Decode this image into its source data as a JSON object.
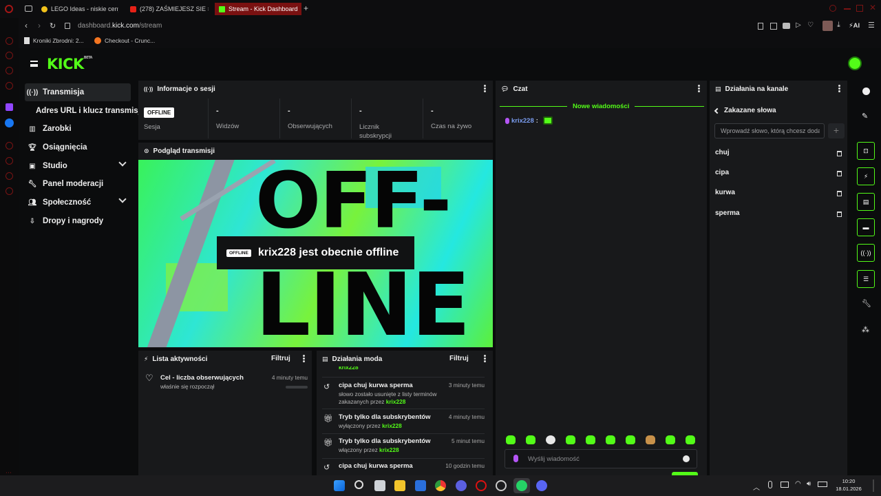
{
  "browser": {
    "tabs": [
      {
        "label": "LEGO Ideas - niskie ceny i..."
      },
      {
        "label": "(278) ZAŚMIEJESZ SIE = ..."
      },
      {
        "label": "Stream - Kick Dashboard"
      }
    ],
    "url_prefix": "dashboard.",
    "url_domain": "kick.com",
    "url_path": "/stream",
    "ai_label": "AI",
    "bookmarks": [
      {
        "label": "Kroniki Zbrodni: 2..."
      },
      {
        "label": "Checkout - Crunc..."
      }
    ]
  },
  "kick": {
    "logo": "KICK",
    "logo_badge": "BETA",
    "nav": [
      {
        "label": "Transmisja",
        "icon": "broadcast-icon"
      },
      {
        "label": "Adres URL i klucz transmisji",
        "icon": ""
      },
      {
        "label": "Zarobki",
        "icon": "chart-icon"
      },
      {
        "label": "Osiągnięcia",
        "icon": "trophy-icon"
      },
      {
        "label": "Studio",
        "icon": "studio-icon"
      },
      {
        "label": "Panel moderacji",
        "icon": "wrench-icon"
      },
      {
        "label": "Społeczność",
        "icon": "people-icon"
      },
      {
        "label": "Dropy i nagrody",
        "icon": "drops-icon"
      }
    ],
    "session": {
      "title": "Informacje o sesji",
      "status_badge": "OFFLINE",
      "status_label": "Sesja",
      "stats": [
        {
          "value": "-",
          "label": "Widzów"
        },
        {
          "value": "-",
          "label": "Obserwujących"
        },
        {
          "value": "-",
          "label": "Licznik subskrypcji"
        },
        {
          "value": "-",
          "label": "Czas na żywo"
        }
      ]
    },
    "preview": {
      "title": "Podgląd transmisji",
      "badge": "OFFLINE",
      "message": "krix228 jest obecnie offline",
      "art_top": "OFF-",
      "art_bottom": "LINE"
    },
    "activity": {
      "title": "Lista aktywności",
      "filter": "Filtruj",
      "items": [
        {
          "title": "Cel - liczba obserwujących",
          "subtitle": "właśnie się rozpoczął",
          "time": "4 minuty temu"
        }
      ]
    },
    "mod_actions": {
      "title": "Działania moda",
      "filter": "Filtruj",
      "cutoff_user": "krix228",
      "items": [
        {
          "title": "cipa chuj kurwa sperma",
          "sub_text": "słowo zostało usunięte z listy terminów zakazanych przez ",
          "user": "krix228",
          "time": "3 minuty temu"
        },
        {
          "title": "Tryb tylko dla subskrybentów",
          "sub_text": "wyłączony przez ",
          "user": "krix228",
          "time": "4 minuty temu"
        },
        {
          "title": "Tryb tylko dla subskrybentów",
          "sub_text": "włączony przez ",
          "user": "krix228",
          "time": "5 minut temu"
        },
        {
          "title": "cipa chuj kurwa sperma",
          "sub_text": "",
          "user": "",
          "time": "10 godzin temu"
        }
      ]
    },
    "chat": {
      "title": "Czat",
      "new_messages": "Nowe wiadomości",
      "username": "krix228",
      "colon": ":",
      "input_placeholder": "Wyślij wiadomość"
    },
    "channel_actions": {
      "title": "Działania na kanale",
      "section": "Zakazane słowa",
      "input_placeholder": "Wprowadź słowo, którą chcesz dodać",
      "add_symbol": "+",
      "words": [
        "chuj",
        "cipa",
        "kurwa",
        "sperma"
      ]
    }
  },
  "taskbar": {
    "time": "10:20",
    "date": "18.01.2026"
  }
}
